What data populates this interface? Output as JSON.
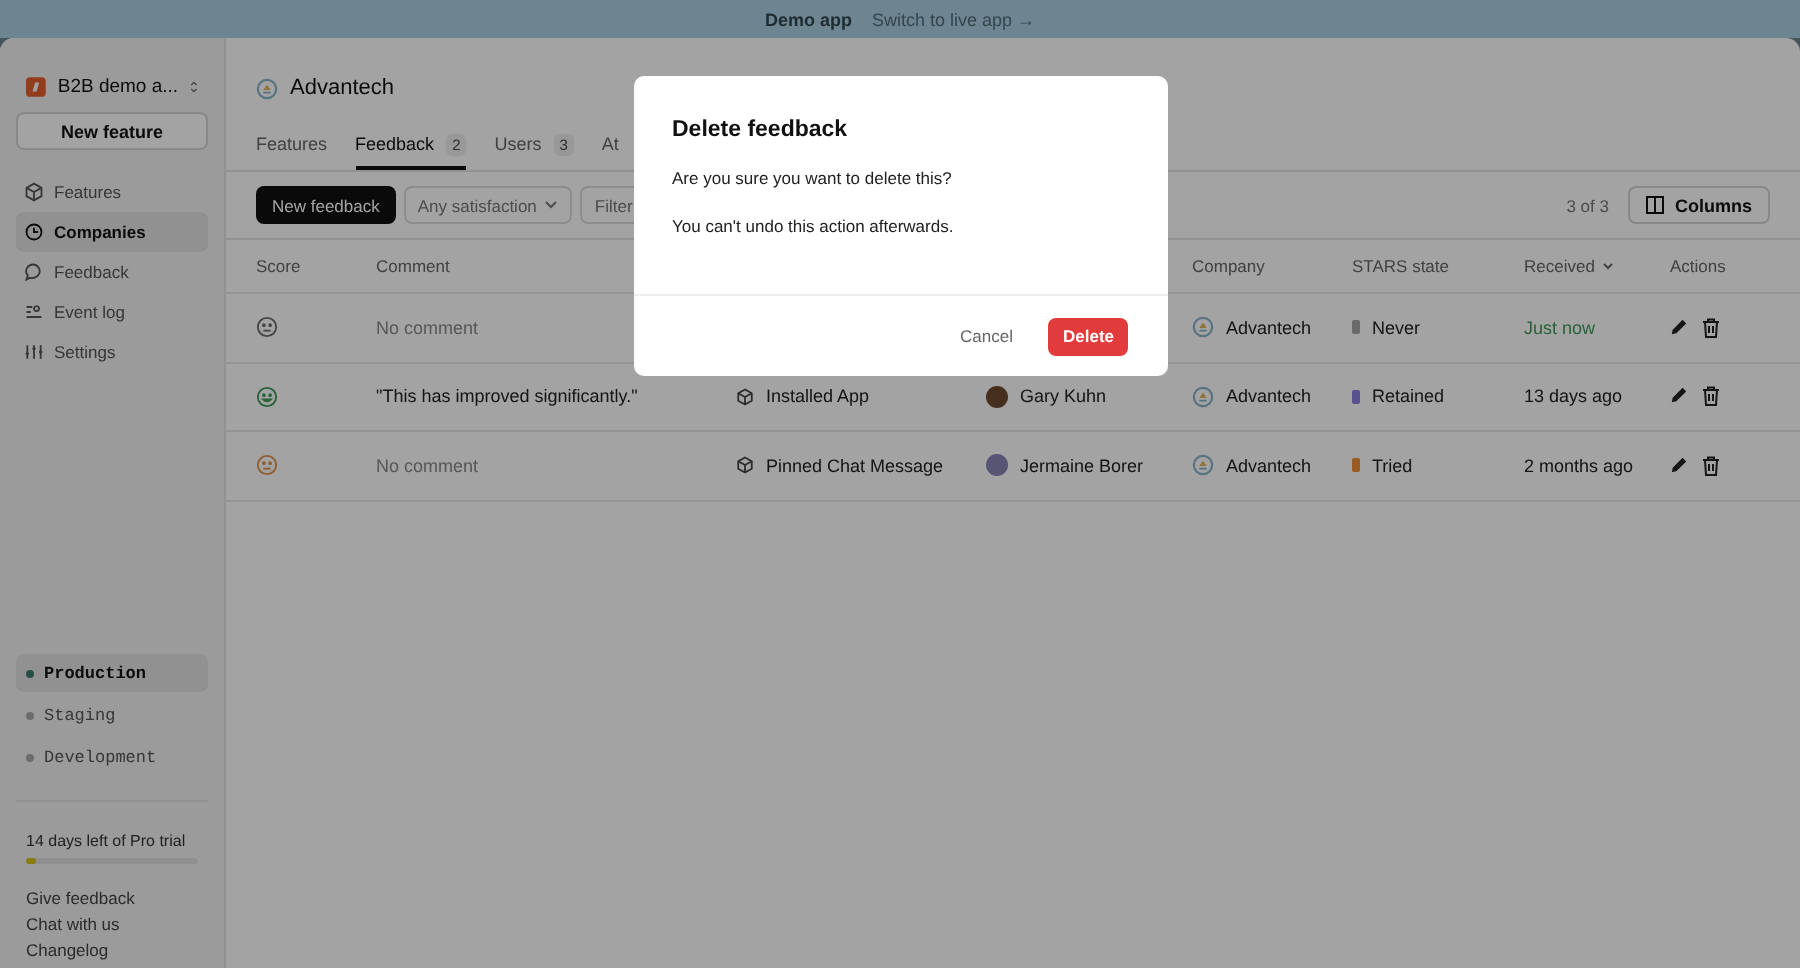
{
  "banner": {
    "title": "Demo app",
    "link": "Switch to live app →"
  },
  "sidebar": {
    "workspace": "B2B demo a...",
    "new_button": "New feature",
    "nav": [
      {
        "label": "Features",
        "selected": false
      },
      {
        "label": "Companies",
        "selected": true
      },
      {
        "label": "Feedback",
        "selected": false
      },
      {
        "label": "Event log",
        "selected": false
      },
      {
        "label": "Settings",
        "selected": false
      }
    ],
    "environments": [
      {
        "label": "Production",
        "selected": true
      },
      {
        "label": "Staging",
        "selected": false
      },
      {
        "label": "Development",
        "selected": false
      }
    ],
    "trial": {
      "text": "14 days left of Pro trial",
      "level": 0.06
    },
    "links": [
      "Give feedback",
      "Chat with us",
      "Changelog"
    ]
  },
  "main": {
    "company": "Advantech",
    "tabs": [
      {
        "label": "Features",
        "selected": false
      },
      {
        "label": "Feedback",
        "count": "2",
        "selected": true
      },
      {
        "label": "Users",
        "count": "3",
        "selected": false
      },
      {
        "label": "At",
        "selected": false
      }
    ],
    "toolbar": {
      "new_button": "New feedback",
      "satisfaction": "Any satisfaction",
      "filter": "Filter",
      "count": "3 of 3",
      "columns_button": "Columns"
    },
    "table": {
      "columns": [
        "Score",
        "Comment",
        "",
        "",
        "Company",
        "STARS state",
        "Received",
        "Actions"
      ],
      "rows": [
        {
          "score": {
            "kind": "neutral"
          },
          "comment": "No comment",
          "comment_empty": true,
          "company": "Advantech",
          "state": {
            "label": "Never",
            "color": "#6b6b6b"
          },
          "received": "Just now",
          "received_recent": true
        },
        {
          "score": {
            "kind": "happy"
          },
          "comment": "\"This has improved significantly.\"",
          "comment_empty": false,
          "feature": "Installed App",
          "user": "Gary Kuhn",
          "company": "Advantech",
          "state": {
            "label": "Retained",
            "color": "#59518f"
          },
          "received": "13 days ago",
          "received_recent": false
        },
        {
          "score": {
            "kind": "meh"
          },
          "comment": "No comment",
          "comment_empty": true,
          "feature": "Pinned Chat Message",
          "user": "Jermaine Borer",
          "company": "Advantech",
          "state": {
            "label": "Tried",
            "color": "#9a5d25"
          },
          "received": "2 months ago",
          "received_recent": false
        }
      ]
    }
  },
  "dialog": {
    "title": "Delete feedback",
    "lines": [
      "Are you sure you want to delete this?",
      "You can't undo this action afterwards."
    ],
    "cancel": "Cancel",
    "confirm": "Delete"
  }
}
